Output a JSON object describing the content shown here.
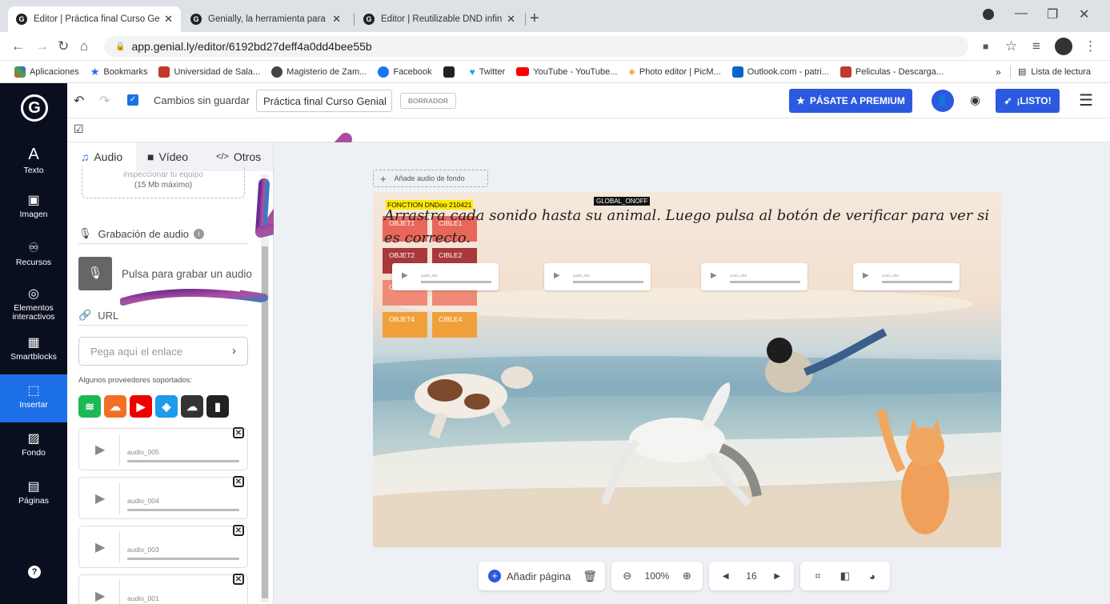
{
  "browser": {
    "tabs": [
      {
        "title": "Editor | Práctica final Curso Genia",
        "active": true
      },
      {
        "title": "Genially, la herramienta para crea",
        "active": false
      },
      {
        "title": "Editor | Reutilizable DND infinito",
        "active": false
      }
    ],
    "url": "app.genial.ly/editor/6192bd27deff4a0dd4bee55b",
    "bookmarks": [
      "Aplicaciones",
      "Bookmarks",
      "Universidad de Sala...",
      "Magisterio de Zam...",
      "Facebook",
      "Twitter",
      "YouTube - YouTube...",
      "Photo editor | PicM...",
      "Outlook.com - patri...",
      "Peliculas - Descarga..."
    ],
    "reading_list": "Lista de lectura",
    "overflow": "»"
  },
  "app": {
    "status": "Cambios sin guardar",
    "title_value": "Práctica final Curso Genial",
    "draft_badge": "BORRADOR",
    "premium_label": "PÁSATE A PREMIUM",
    "ready_label": "¡LISTO!"
  },
  "leftnav": [
    {
      "label": "Texto",
      "icon": "A"
    },
    {
      "label": "Imagen",
      "icon": "🖼"
    },
    {
      "label": "Recursos",
      "icon": "⚬"
    },
    {
      "label": "Elementos interactivos",
      "icon": "◎"
    },
    {
      "label": "Smartblocks",
      "icon": "▦"
    },
    {
      "label": "Insertar",
      "icon": "⬚"
    },
    {
      "label": "Fondo",
      "icon": "▨"
    },
    {
      "label": "Páginas",
      "icon": "▤"
    }
  ],
  "panel": {
    "tabs": [
      "Audio",
      "Vídeo",
      "Otros"
    ],
    "upload_hint_1": "inspeccionar tu equipo",
    "upload_hint_2": "(15 Mb máximo)",
    "recording_title": "Grabación de audio",
    "record_button": "Pulsa para grabar un audio",
    "url_title": "URL",
    "url_placeholder": "Pega aquí el enlace",
    "providers_title": "Algunos proveedores soportados:",
    "audios": [
      "audio_005",
      "audio_004",
      "audio_003",
      "audio_001"
    ]
  },
  "canvas": {
    "bg_audio": "Añade audio de fondo",
    "tag_function": "FONCTION DNDoo 210421",
    "tag_global": "GLOBAL_ONOFF",
    "instruction": "Arrastra cada sonido hasta su animal. Luego pulsa al botón de verificar para ver si es correcto.",
    "dnd": [
      {
        "obj": "OBJET1",
        "cible": "CIBLE1"
      },
      {
        "obj": "OBJET2",
        "cible": "CIBLE2"
      },
      {
        "obj": "OBJET3",
        "cible": "CIBLE3"
      },
      {
        "obj": "OBJET4",
        "cible": "CIBLE4"
      }
    ],
    "players": [
      "audio_001",
      "audio_002",
      "audio_003",
      "audio_004"
    ]
  },
  "bottombar": {
    "add_page": "Añadir página",
    "zoom": "100%",
    "page": "16"
  },
  "colors": {
    "nav_bg": "#0a0f1f",
    "accent": "#1d6fe8",
    "premium": "#2b59e0",
    "obj_red": "#e8675a",
    "obj_dark": "#a8383a",
    "obj_orange": "#f0a03a"
  }
}
